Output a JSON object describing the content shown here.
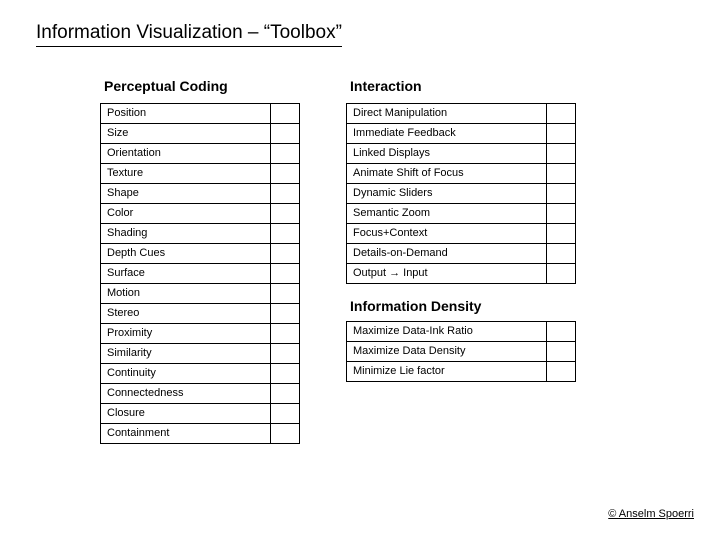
{
  "title": "Information Visualization – “Toolbox”",
  "left": {
    "header": "Perceptual Coding",
    "items": [
      "Position",
      "Size",
      "Orientation",
      "Texture",
      "Shape",
      "Color",
      "Shading",
      "Depth Cues",
      "Surface",
      "Motion",
      "Stereo",
      "Proximity",
      "Similarity",
      "Continuity",
      "Connectedness",
      "Closure",
      "Containment"
    ]
  },
  "right": {
    "section1": {
      "header": "Interaction",
      "items": [
        "Direct Manipulation",
        "Immediate Feedback",
        "Linked Displays",
        "Animate Shift of Focus",
        "Dynamic Sliders",
        "Semantic Zoom",
        "Focus+Context",
        "Details-on-Demand",
        "Output → Input"
      ]
    },
    "section2": {
      "header": "Information Density",
      "items": [
        "Maximize Data-Ink Ratio",
        "Maximize Data Density",
        "Minimize Lie factor"
      ]
    }
  },
  "attribution": "© Anselm Spoerri"
}
